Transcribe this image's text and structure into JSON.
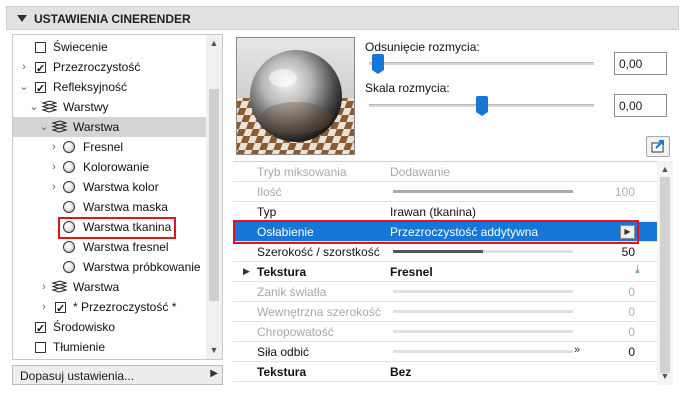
{
  "panel": {
    "title": "USTAWIENIA CINERENDER"
  },
  "tree": {
    "items": [
      {
        "label": "Świecenie",
        "checked": false
      },
      {
        "label": "Przezroczystość",
        "checked": true
      },
      {
        "label": "Refleksyjność",
        "checked": true
      },
      {
        "label": "Warstwy"
      },
      {
        "label": "Warstwa"
      },
      {
        "label": "Fresnel"
      },
      {
        "label": "Kolorowanie"
      },
      {
        "label": "Warstwa kolor"
      },
      {
        "label": "Warstwa maska"
      },
      {
        "label": "Warstwa tkanina"
      },
      {
        "label": "Warstwa fresnel"
      },
      {
        "label": "Warstwa próbkowanie"
      },
      {
        "label": "Warstwa"
      },
      {
        "label": "* Przezroczystość *",
        "checked": true
      },
      {
        "label": "Środowisko",
        "checked": true
      },
      {
        "label": "Tłumienie",
        "checked": false
      }
    ],
    "selected_index": 4
  },
  "adjust_button": {
    "label": "Dopasuj ustawienia..."
  },
  "sliders": {
    "blur_offset": {
      "label": "Odsunięcie rozmycia:",
      "value": "0,00",
      "level": 0.0
    },
    "blur_scale": {
      "label": "Skala rozmycia:",
      "value": "0,00",
      "level": 0.5
    }
  },
  "properties": [
    {
      "name": "Tryb miksowania",
      "value": "Dodawanie",
      "disabled": true
    },
    {
      "name": "Ilość",
      "num": "100",
      "level": 1.0,
      "disabled": true
    },
    {
      "name": "Typ",
      "value": "Irawan (tkanina)"
    },
    {
      "name": "Osłabienie",
      "value": "Przezroczystość addytywna",
      "selected": true
    },
    {
      "name": "Szerokość / szorstkość",
      "num": "50",
      "level": 0.5
    },
    {
      "name": "Tekstura",
      "value": "Fresnel",
      "bold": true
    },
    {
      "name": "Zanik światła",
      "num": "0",
      "level": 0.0,
      "disabled": true
    },
    {
      "name": "Wewnętrzna szerokość",
      "num": "0",
      "level": 0.0,
      "disabled": true
    },
    {
      "name": "Chropowatość",
      "num": "0",
      "level": 0.0,
      "disabled": true
    },
    {
      "name": "Siła odbić",
      "num": "0",
      "level": 0.0
    },
    {
      "name": "Tekstura",
      "value": "Bez",
      "bold": true
    }
  ],
  "colors": {
    "accent": "#1677d6",
    "highlight": "#e0141c",
    "header_bg": "#e2e2e2"
  }
}
